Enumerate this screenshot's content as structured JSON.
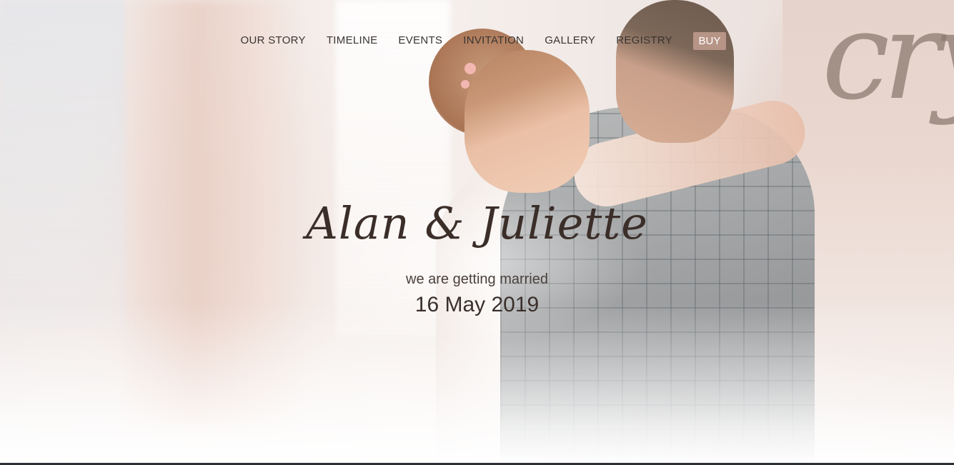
{
  "nav": {
    "items": [
      {
        "label": "OUR STORY"
      },
      {
        "label": "TIMELINE"
      },
      {
        "label": "EVENTS"
      },
      {
        "label": "INVITATION"
      },
      {
        "label": "GALLERY"
      },
      {
        "label": "REGISTRY"
      }
    ],
    "buy_label": "BUY"
  },
  "hero": {
    "names": "Alan & Juliette",
    "tagline": "we are getting married",
    "date": "16 May 2019"
  },
  "colors": {
    "accent": "#b79586",
    "text": "#3a302c"
  }
}
